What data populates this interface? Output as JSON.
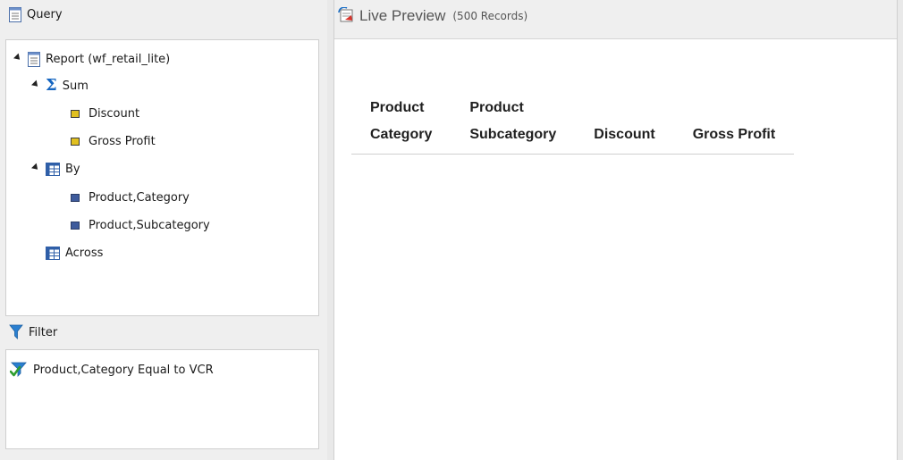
{
  "query_panel": {
    "title": "Query",
    "tree": {
      "report_label": "Report (wf_retail_lite)",
      "sum_label": "Sum",
      "sum_fields": [
        "Discount",
        "Gross Profit"
      ],
      "by_label": "By",
      "by_fields": [
        "Product,Category",
        "Product,Subcategory"
      ],
      "across_label": "Across"
    }
  },
  "filter_panel": {
    "title": "Filter",
    "conditions": [
      "Product,Category Equal to VCR"
    ]
  },
  "preview": {
    "title": "Live Preview",
    "count": "(500 Records)",
    "columns": [
      {
        "line1": "Product",
        "line2": "Category"
      },
      {
        "line1": "Product",
        "line2": "Subcategory"
      },
      {
        "line1": "",
        "line2": "Discount"
      },
      {
        "line1": "",
        "line2": "Gross Profit"
      }
    ]
  },
  "colors": {
    "sigma": "#1565c0",
    "sum_field": "#e1c020",
    "by_field": "#3e5b9c",
    "filter_check": "#2e9d2e"
  }
}
